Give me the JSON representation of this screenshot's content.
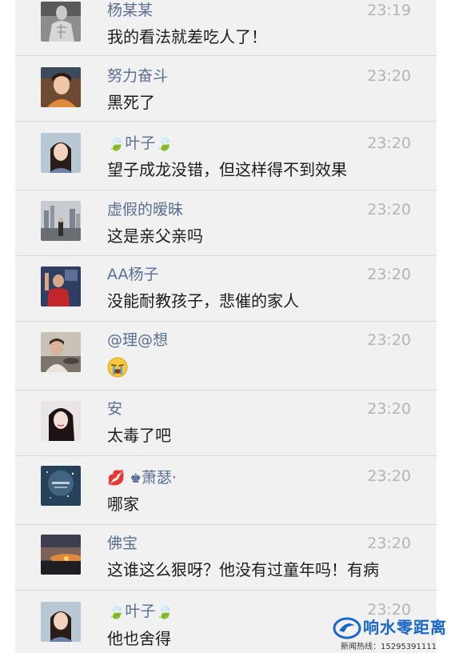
{
  "comments": [
    {
      "name": "杨某某",
      "time": "23:19",
      "message": "我的看法就差吃人了！",
      "avatar": "avatar-shirtless-man"
    },
    {
      "name": "努力奋斗",
      "time": "23:20",
      "message": "黑死了",
      "avatar": "avatar-woman"
    },
    {
      "name": "叶子",
      "name_decor": "leaf-emoji",
      "time": "23:20",
      "message": "望子成龙没错，但这样得不到效果",
      "avatar": "avatar-girl"
    },
    {
      "name": "虚假的暧昧",
      "time": "23:20",
      "message": "这是亲父亲吗",
      "avatar": "avatar-city-skyline"
    },
    {
      "name": "AA杨子",
      "time": "23:20",
      "message": "没能耐教孩子，悲催的家人",
      "avatar": "avatar-man-red-shirt"
    },
    {
      "name": "@理@想",
      "time": "23:20",
      "message": "",
      "message_emoji": "crying-face-emoji",
      "avatar": "avatar-driver"
    },
    {
      "name": "安",
      "time": "23:20",
      "message": "太毒了吧",
      "avatar": "avatar-woman-dark-hair"
    },
    {
      "name": "萧瑟·",
      "name_decor": "lips-and-crown-emoji",
      "time": "23:20",
      "message": "哪家",
      "avatar": "avatar-starry-sky"
    },
    {
      "name": "佛宝",
      "time": "23:20",
      "message": "这谁这么狠呀？他没有过童年吗！有病",
      "avatar": "avatar-sunset"
    },
    {
      "name": "叶子",
      "name_decor": "leaf-emoji",
      "time": "23:20",
      "message": "他也舍得",
      "avatar": "avatar-girl"
    }
  ],
  "watermark": {
    "title": "响水零距离",
    "subtitle": "新闻热线：15295391111",
    "logo": "swirl-logo-icon"
  },
  "colors": {
    "background": "#f1f1f1",
    "name": "#5b6f92",
    "time": "#b4b4b4",
    "message": "#1d1d1d",
    "divider": "#d9d9d9",
    "watermark_blue": "#1a67c8"
  }
}
